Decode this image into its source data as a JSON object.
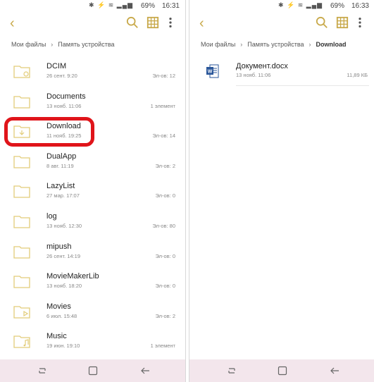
{
  "left": {
    "status": {
      "icons": "✱ ⚡ ≋ ▂▄▆",
      "battery": "69%",
      "time": "16:31"
    },
    "breadcrumb": [
      "Мои файлы",
      "Память устройства"
    ],
    "items": [
      {
        "name": "DCIM",
        "date": "26 сент. 9:20",
        "count": "Эл-ов: 12",
        "icon": "folder-camera"
      },
      {
        "name": "Documents",
        "date": "13 нояб. 11:06",
        "count": "1 элемент",
        "icon": "folder"
      },
      {
        "name": "Download",
        "date": "11 нояб. 19:25",
        "count": "Эл-ов: 14",
        "icon": "folder-download"
      },
      {
        "name": "DualApp",
        "date": "8 авг. 11:19",
        "count": "Эл-ов: 2",
        "icon": "folder"
      },
      {
        "name": "LazyList",
        "date": "27 мар. 17:07",
        "count": "Эл-ов: 0",
        "icon": "folder"
      },
      {
        "name": "log",
        "date": "13 нояб. 12:30",
        "count": "Эл-ов: 80",
        "icon": "folder"
      },
      {
        "name": "mipush",
        "date": "26 сент. 14:19",
        "count": "Эл-ов: 0",
        "icon": "folder"
      },
      {
        "name": "MovieMakerLib",
        "date": "13 нояб. 18:20",
        "count": "Эл-ов: 0",
        "icon": "folder"
      },
      {
        "name": "Movies",
        "date": "6 июл. 15:48",
        "count": "Эл-ов: 2",
        "icon": "folder-video"
      },
      {
        "name": "Music",
        "date": "19 июн. 19:10",
        "count": "1 элемент",
        "icon": "folder-music"
      }
    ]
  },
  "right": {
    "status": {
      "icons": "✱ ⚡ ≋ ▂▄▆",
      "battery": "69%",
      "time": "16:33"
    },
    "breadcrumb": [
      "Мои файлы",
      "Память устройства",
      "Download"
    ],
    "file": {
      "name": "Документ.docx",
      "date": "13 нояб. 11:06",
      "size": "11,89 КБ"
    }
  },
  "colors": {
    "accent": "#c8a94a",
    "highlight": "#e0141a",
    "navbar": "#f3e6ec"
  }
}
